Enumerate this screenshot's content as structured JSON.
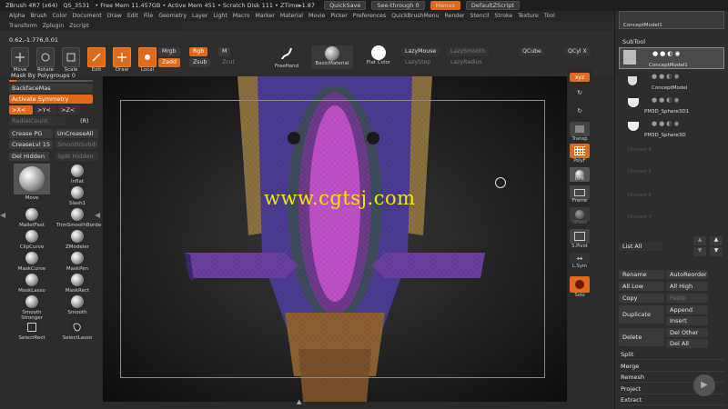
{
  "titlebar": {
    "items": [
      "ZBrush 4R7 (x64)",
      "QS_3531",
      "• Free Mem 11.457GB • Active Mem 451 • Scratch Disk 111 • ZTime▸1.87"
    ],
    "quicksave": "QuickSave",
    "seethrough": "See-through  0",
    "menus": "Menus",
    "defaultzscript": "DefaultZScript"
  },
  "menubar": [
    "Alpha",
    "Brush",
    "Color",
    "Document",
    "Draw",
    "Edit",
    "File",
    "Geometry",
    "Layer",
    "Light",
    "Macro",
    "Marker",
    "Material",
    "Movie",
    "Picker",
    "Preferences",
    "QuickBrushMenu",
    "Render",
    "Stencil",
    "Stroke",
    "Texture",
    "Tool"
  ],
  "submenubar": [
    "Transform",
    "Zplugin",
    "Zscript"
  ],
  "shelf": {
    "coords": "0.62,-1.776,0.01",
    "tools": [
      {
        "label": "Move",
        "icon": "move-icon",
        "on": false
      },
      {
        "label": "Rotate",
        "icon": "rotate-icon",
        "on": false
      },
      {
        "label": "Scale",
        "icon": "scale-icon",
        "on": false
      },
      {
        "label": "Edit",
        "icon": "edit-icon",
        "on": true
      },
      {
        "label": "Draw",
        "icon": "draw-icon",
        "on": true
      },
      {
        "label": "Local",
        "icon": "local-icon",
        "on": true
      }
    ],
    "mrgb": "Mrgb",
    "rgb": "Rgb",
    "m": "M",
    "zadd": "Zadd",
    "zsub": "Zsub",
    "zcut": "Zcut",
    "freehand": "FreeHand",
    "material": "BasicMaterial",
    "flatcolor": "Flat Color",
    "lazymouse": "LazyMouse",
    "lazysmooth": "LazySmooth",
    "lazystep": "LazyStep",
    "lazyradius": "LazyRadius",
    "qcube": "QCube",
    "qcyl": "QCyl X"
  },
  "leftpanel": {
    "mask_by_polygroups": "Mask By Polygroups 0",
    "backfacemask": "BackfaceMas",
    "activate_symmetry": "Activate Symmetry",
    "axes": [
      ">X<",
      ">Y<",
      ">Z<"
    ],
    "radialcount": "RadialCount",
    "r": "(R)",
    "crease_pg": "Crease PG",
    "uncrease_all": "UnCreaseAll",
    "crease_lvl": "CreaseLvl 15",
    "smooth_subdiv": "SmoothSubdi",
    "del_hidden": "Del Hidden",
    "split_hidden": "Split Hidden",
    "brushes": [
      {
        "label": "Move"
      },
      {
        "label": "Inflat"
      },
      {
        "label": ""
      },
      {
        "label": "Slash1"
      },
      {
        "label": "MalletFast"
      },
      {
        "label": "TrimSmoothBorde"
      },
      {
        "label": "ClipCurve"
      },
      {
        "label": "ZModeler"
      },
      {
        "label": "MaskCurve"
      },
      {
        "label": "MaskPen"
      },
      {
        "label": "MaskLasso"
      },
      {
        "label": "MaskRect"
      },
      {
        "label": "Smooth Stronger"
      },
      {
        "label": "Smooth"
      },
      {
        "label": "SelectRect"
      },
      {
        "label": "SelectLasso"
      }
    ]
  },
  "viewport": {
    "watermark": "www.cgtsj.com"
  },
  "rightcol": {
    "xyz": "xyz",
    "transp": "Transp",
    "polyf": "PolyF",
    "bpr": "BPR",
    "frame": "Frame",
    "ghost": "Ghost",
    "spivot": "S.Pivot",
    "lsym": "L.Sym",
    "solo": "Solo"
  },
  "subtool": {
    "header": "SubTool",
    "top_name": "ConceptModel1",
    "items": [
      {
        "name": "ConceptModel1",
        "active": true
      },
      {
        "name": "ConceptModel",
        "active": false
      },
      {
        "name": "PM3D_Sphere3D1",
        "active": false
      },
      {
        "name": "PM3D_Sphere3D",
        "active": false
      }
    ],
    "ghost_slots": [
      "Unused 4",
      "Unused 5",
      "Unused 6",
      "Unused 7"
    ],
    "list_all": "List All",
    "buttons": {
      "rename": "Rename",
      "autoreorder": "AutoReorder",
      "alllow": "All Low",
      "allhigh": "All High",
      "copy": "Copy",
      "paste": "Paste",
      "duplicate": "Duplicate",
      "append": "Append",
      "insert": "Insert",
      "delete": "Delete",
      "delother": "Del Other",
      "delall": "Del All"
    },
    "actions": [
      "Split",
      "Merge",
      "Remesh",
      "Project",
      "Extract"
    ]
  },
  "colors": {
    "accent": "#e06a1c",
    "panel": "#2c2c2c",
    "watermark": "#f2e800",
    "model_purple": "#5a3f8e",
    "model_magenta": "#c050c8",
    "model_tan": "#8a7040"
  }
}
